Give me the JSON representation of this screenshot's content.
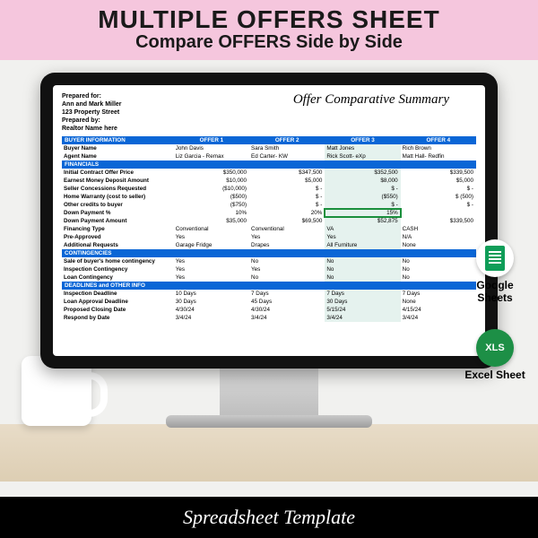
{
  "banner": {
    "line1": "MULTIPLE OFFERS SHEET",
    "line2_a": "Compare ",
    "line2_b": "OFFERS",
    "line2_c": " Side by Side"
  },
  "bottom": "Spreadsheet Template",
  "sheet_heading": "Offer Comparative Summary",
  "prep": {
    "for": "Prepared for:",
    "name": "Ann and Mark Miller",
    "addr": "123 Property Street",
    "by": "Prepared by:",
    "realtor": "Realtor Name here"
  },
  "sections": {
    "buyer": "BUYER INFORMATION",
    "fin": "FINANCIALS",
    "cont": "CONTINGENCIES",
    "dead": "DEADLINES and OTHER INFO"
  },
  "offer_hdrs": [
    "OFFER 1",
    "OFFER 2",
    "OFFER 3",
    "OFFER 4"
  ],
  "rows": {
    "buyer_name": {
      "l": "Buyer Name",
      "v": [
        "John Davis",
        "Sara Smith",
        "Matt Jones",
        "Rich Brown"
      ]
    },
    "agent": {
      "l": "Agent Name",
      "v": [
        "Liz Garcia - Remax",
        "Ed Carter- KW",
        "Rick Scott- eXp",
        "Matt Hall- Redfin"
      ]
    },
    "price": {
      "l": "Initial Contract Offer Price",
      "v": [
        "$350,000",
        "$347,500",
        "$352,500",
        "$339,500"
      ]
    },
    "earnest": {
      "l": "Earnest Money Deposit Amount",
      "v": [
        "$10,000",
        "$5,000",
        "$8,000",
        "$5,000"
      ]
    },
    "conc": {
      "l": "Seller Concessions Requested",
      "v": [
        "($10,000)",
        "$         -",
        "$         -",
        "$         -"
      ]
    },
    "warr": {
      "l": "Home Warranty (cost to seller)",
      "v": [
        "($500)",
        "$         -",
        "($550)",
        "$      (500)"
      ]
    },
    "cred": {
      "l": "Other credits to buyer",
      "v": [
        "($750)",
        "$         -",
        "$         -",
        "$         -"
      ]
    },
    "dp_pct": {
      "l": "Down Payment %",
      "v": [
        "10%",
        "20%",
        "15%",
        ""
      ]
    },
    "dp_amt": {
      "l": "Down Payment Amount",
      "v": [
        "$35,000",
        "$69,500",
        "$52,875",
        "$339,500"
      ]
    },
    "fin": {
      "l": "Financing Type",
      "v": [
        "Conventional",
        "Conventional",
        "VA",
        "CASH"
      ]
    },
    "pre": {
      "l": "Pre-Approved",
      "v": [
        "Yes",
        "Yes",
        "Yes",
        "N/A"
      ]
    },
    "addreq": {
      "l": "Additional Requests",
      "v": [
        "Garage Fridge",
        "Drapes",
        "All Furniture",
        "None"
      ]
    },
    "sale": {
      "l": "Sale of buyer's home contingency",
      "v": [
        "Yes",
        "No",
        "No",
        "No"
      ]
    },
    "insp": {
      "l": "Inspection Contingency",
      "v": [
        "Yes",
        "Yes",
        "No",
        "No"
      ]
    },
    "loan": {
      "l": "Loan Contingency",
      "v": [
        "Yes",
        "No",
        "No",
        "No"
      ]
    },
    "insp_d": {
      "l": "Inspection Deadline",
      "v": [
        "10 Days",
        "7 Days",
        "7 Days",
        "7 Days"
      ]
    },
    "loan_d": {
      "l": "Loan Approval Deadline",
      "v": [
        "30 Days",
        "45 Days",
        "30 Days",
        "None"
      ]
    },
    "close": {
      "l": "Proposed Closing Date",
      "v": [
        "4/30/24",
        "4/30/24",
        "5/15/24",
        "4/15/24"
      ]
    },
    "resp": {
      "l": "Respond by Date",
      "v": [
        "3/4/24",
        "3/4/24",
        "3/4/24",
        "3/4/24"
      ]
    }
  },
  "badges": {
    "gs": "Google Sheets",
    "xs_icon": "XLS",
    "xs": "Excel Sheet"
  }
}
